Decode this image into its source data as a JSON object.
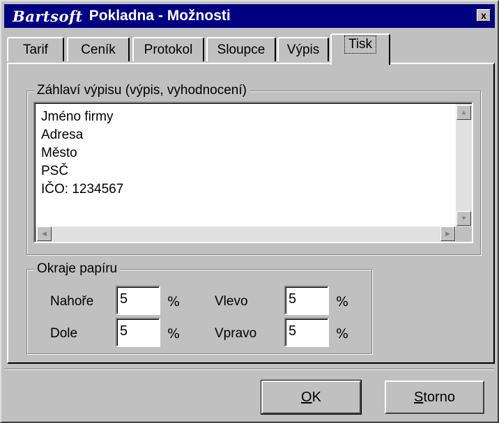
{
  "window": {
    "brand": "Bartsoft",
    "title": "Pokladna - Možnosti",
    "close_label": "x"
  },
  "tabs": [
    {
      "label": "Tarif",
      "active": false
    },
    {
      "label": "Ceník",
      "active": false
    },
    {
      "label": "Protokol",
      "active": false
    },
    {
      "label": "Sloupce",
      "active": false
    },
    {
      "label": "Výpis",
      "active": false
    },
    {
      "label": "Tisk",
      "active": true
    }
  ],
  "header_group": {
    "legend": "Záhlaví výpisu (výpis, vyhodnocení)",
    "lines": [
      "Jméno firmy",
      "Adresa",
      "Město",
      "PSČ",
      "IČO: 1234567"
    ]
  },
  "margins_group": {
    "legend": "Okraje papíru",
    "top_label": "Nahoře",
    "top_value": "5",
    "bottom_label": "Dole",
    "bottom_value": "5",
    "left_label": "Vlevo",
    "left_value": "5",
    "right_label": "Vpravo",
    "right_value": "5",
    "unit": "%"
  },
  "buttons": {
    "ok_mnemonic": "O",
    "ok_rest": "K",
    "cancel_mnemonic": "S",
    "cancel_rest": "torno"
  }
}
